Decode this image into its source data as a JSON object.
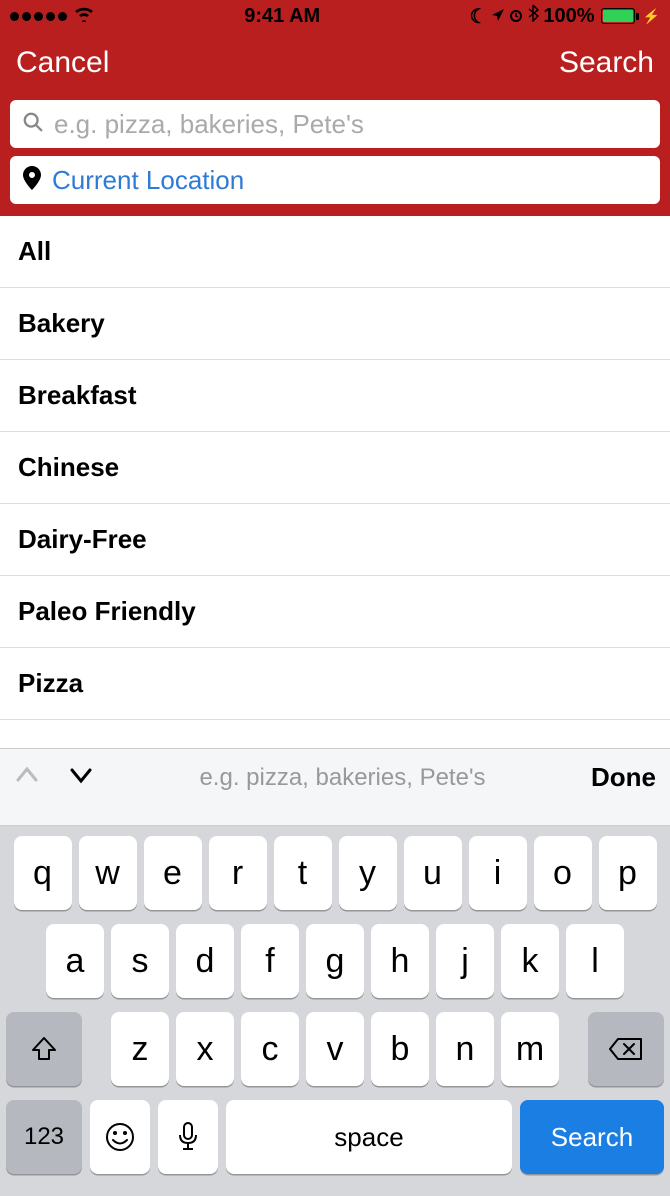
{
  "status_bar": {
    "time": "9:41 AM",
    "battery": "100%"
  },
  "nav": {
    "cancel": "Cancel",
    "search": "Search"
  },
  "search": {
    "placeholder": "e.g. pizza, bakeries, Pete's",
    "location_value": "Current Location"
  },
  "categories": [
    "All",
    "Bakery",
    "Breakfast",
    "Chinese",
    "Dairy-Free",
    "Paleo Friendly",
    "Pizza"
  ],
  "keyboard": {
    "accessory_hint": "e.g. pizza, bakeries, Pete's",
    "done": "Done",
    "row1": [
      "q",
      "w",
      "e",
      "r",
      "t",
      "y",
      "u",
      "i",
      "o",
      "p"
    ],
    "row2": [
      "a",
      "s",
      "d",
      "f",
      "g",
      "h",
      "j",
      "k",
      "l"
    ],
    "row3": [
      "z",
      "x",
      "c",
      "v",
      "b",
      "n",
      "m"
    ],
    "numkey": "123",
    "space": "space",
    "search": "Search"
  }
}
